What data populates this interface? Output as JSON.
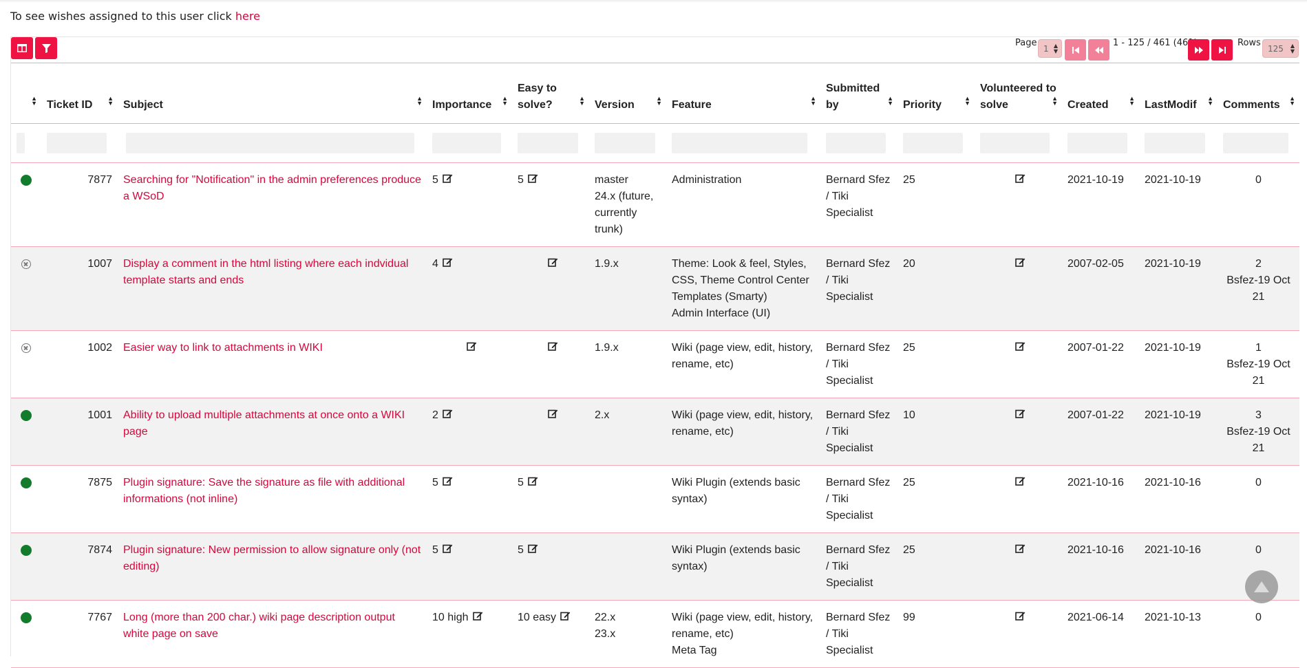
{
  "intro": {
    "text": "To see wishes assigned to this user click ",
    "link": "here"
  },
  "toolbar": {
    "columns_icon": "columns-icon",
    "filter_icon": "filter-icon"
  },
  "pager": {
    "page_label": "Page",
    "page_value": "1",
    "range": "1 - 125 / 461 (461)",
    "rows_label": "Rows",
    "rows_value": "125"
  },
  "colors": {
    "accent": "#ee1342",
    "link": "#d7063b",
    "status_open": "#137c2c"
  },
  "columns": [
    "",
    "Ticket ID",
    "Subject",
    "Importance",
    "Easy to solve?",
    "Version",
    "Feature",
    "Submitted by",
    "Priority",
    "Volunteered to solve",
    "Created",
    "LastModif",
    "Comments"
  ],
  "rows": [
    {
      "status": "open",
      "id": "7877",
      "subject": "Searching for \"Notification\" in the admin preferences produce a WSoD",
      "importance": "5",
      "easy": "5",
      "version": [
        "master",
        "24.x (future, currently trunk)"
      ],
      "feature": [
        "Administration"
      ],
      "submitted": "Bernard Sfez / Tiki Specialist",
      "priority": "25",
      "created": "2021-10-19",
      "modified": "2021-10-19",
      "comments": [
        "0"
      ]
    },
    {
      "status": "closed",
      "id": "1007",
      "subject": "Display a comment in the html listing where each indvidual template starts and ends",
      "importance": "4",
      "easy": "",
      "version": [
        "1.9.x"
      ],
      "feature": [
        "Theme: Look & feel, Styles, CSS, Theme Control Center",
        "Templates (Smarty)",
        "Admin Interface (UI)"
      ],
      "submitted": "Bernard Sfez / Tiki Specialist",
      "priority": "20",
      "created": "2007-02-05",
      "modified": "2021-10-19",
      "comments": [
        "2",
        "Bsfez-19 Oct 21"
      ]
    },
    {
      "status": "closed",
      "id": "1002",
      "subject": "Easier way to link to attachments in WIKI",
      "importance": "",
      "easy": "",
      "version": [
        "1.9.x"
      ],
      "feature": [
        "Wiki (page view, edit, history, rename, etc)"
      ],
      "submitted": "Bernard Sfez / Tiki Specialist",
      "priority": "25",
      "created": "2007-01-22",
      "modified": "2021-10-19",
      "comments": [
        "1",
        "Bsfez-19 Oct 21"
      ]
    },
    {
      "status": "open",
      "id": "1001",
      "subject": "Ability to upload multiple attachments at once onto a WIKI page",
      "importance": "2",
      "easy": "",
      "version": [
        "2.x"
      ],
      "feature": [
        "Wiki (page view, edit, history, rename, etc)"
      ],
      "submitted": "Bernard Sfez / Tiki Specialist",
      "priority": "10",
      "created": "2007-01-22",
      "modified": "2021-10-19",
      "comments": [
        "3",
        "Bsfez-19 Oct 21"
      ]
    },
    {
      "status": "open",
      "id": "7875",
      "subject": "Plugin signature: Save the signature as file with additional informations (not inline)",
      "importance": "5",
      "easy": "5",
      "version": [],
      "feature": [
        "Wiki Plugin (extends basic syntax)"
      ],
      "submitted": "Bernard Sfez / Tiki Specialist",
      "priority": "25",
      "created": "2021-10-16",
      "modified": "2021-10-16",
      "comments": [
        "0"
      ]
    },
    {
      "status": "open",
      "id": "7874",
      "subject": "Plugin signature: New permission to allow signature only (not editing)",
      "importance": "5",
      "easy": "5",
      "version": [],
      "feature": [
        "Wiki Plugin (extends basic syntax)"
      ],
      "submitted": "Bernard Sfez / Tiki Specialist",
      "priority": "25",
      "created": "2021-10-16",
      "modified": "2021-10-16",
      "comments": [
        "0"
      ]
    },
    {
      "status": "open",
      "id": "7767",
      "subject": "Long (more than 200 char.) wiki page description output white page on save",
      "importance": "10 high",
      "easy": "10 easy",
      "version": [
        "22.x",
        "23.x"
      ],
      "feature": [
        "Wiki (page view, edit, history, rename, etc)",
        "Meta Tag"
      ],
      "submitted": "Bernard Sfez / Tiki Specialist",
      "priority": "99",
      "created": "2021-06-14",
      "modified": "2021-10-13",
      "comments": [
        "0"
      ]
    }
  ]
}
